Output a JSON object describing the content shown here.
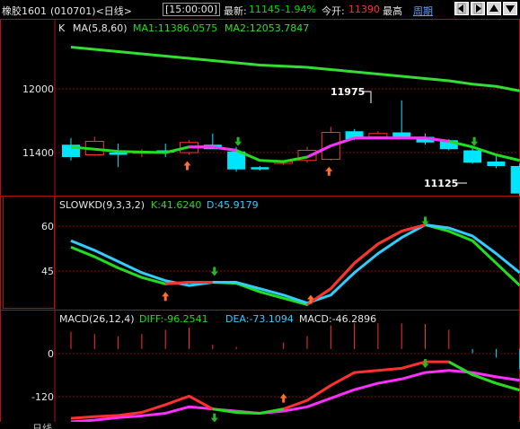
{
  "header": {
    "instrument": "橡胶1601",
    "code_period": "(010701)<日线>",
    "time": "[15:00:00]",
    "latest_label": "最新:",
    "latest_value": "11145",
    "change": "-1.94%",
    "open_label": "今开:",
    "open_value": "11390",
    "high_label": "最高",
    "period_link": "周期",
    "nav_icons": [
      "left-arrow-icon",
      "right-arrow-icon",
      "up-arrow-icon",
      "down-arrow-icon"
    ]
  },
  "price_panel": {
    "title_k": "K",
    "title_ma": "MA(5,8,60)",
    "ma1_text": "MA1:11386.0575",
    "ma2_text": "MA2:12053.7847",
    "axis_labels": [
      "12000",
      "11400"
    ],
    "annotation_high": "11975",
    "annotation_low": "11125"
  },
  "kd_panel": {
    "title": "SLOWKD(9,3,3,2)",
    "k_text": "K:41.6240",
    "d_text": "D:45.9179",
    "axis_labels": [
      "60",
      "45"
    ]
  },
  "macd_panel": {
    "title": "MACD(26,12,4)",
    "diff_text": "DIFF:-96.2541",
    "dea_text": "DEA:-73.1094",
    "macd_text": "MACD:-46.2896",
    "axis_labels": [
      "0",
      "-120"
    ]
  },
  "bottom": {
    "date_label": "日线"
  },
  "colors": {
    "up": "#ff3030",
    "down": "#00e5ff",
    "ma60": "#33dd33",
    "ma_green": "#22dd22",
    "ma_magenta": "#ff30ff",
    "kd_d": "#33ccff",
    "panel_border": "#b01010",
    "grid": "#8b0000"
  },
  "chart_data": [
    {
      "type": "candlestick",
      "candles": [
        {
          "o": 11580,
          "h": 11640,
          "l": 11440,
          "c": 11470
        },
        {
          "o": 11490,
          "h": 11650,
          "l": 11480,
          "c": 11610
        },
        {
          "o": 11510,
          "h": 11590,
          "l": 11380,
          "c": 11490
        },
        {
          "o": 11510,
          "h": 11540,
          "l": 11470,
          "c": 11520
        },
        {
          "o": 11530,
          "h": 11590,
          "l": 11470,
          "c": 11510
        },
        {
          "o": 11510,
          "h": 11620,
          "l": 11490,
          "c": 11600
        },
        {
          "o": 11580,
          "h": 11680,
          "l": 11560,
          "c": 11540
        },
        {
          "o": 11520,
          "h": 11560,
          "l": 11340,
          "c": 11360
        },
        {
          "o": 11380,
          "h": 11390,
          "l": 11350,
          "c": 11360
        },
        {
          "o": 11420,
          "h": 11440,
          "l": 11400,
          "c": 11430
        },
        {
          "o": 11440,
          "h": 11560,
          "l": 11420,
          "c": 11530
        },
        {
          "o": 11450,
          "h": 11740,
          "l": 11440,
          "c": 11690
        },
        {
          "o": 11700,
          "h": 11720,
          "l": 11620,
          "c": 11630
        },
        {
          "o": 11650,
          "h": 11700,
          "l": 11640,
          "c": 11680
        },
        {
          "o": 11690,
          "h": 11975,
          "l": 11660,
          "c": 11630
        },
        {
          "o": 11650,
          "h": 11680,
          "l": 11580,
          "c": 11600
        },
        {
          "o": 11620,
          "h": 11630,
          "l": 11530,
          "c": 11540
        },
        {
          "o": 11530,
          "h": 11560,
          "l": 11410,
          "c": 11420
        },
        {
          "o": 11430,
          "h": 11480,
          "l": 11370,
          "c": 11390
        },
        {
          "o": 11390,
          "h": 11410,
          "l": 11125,
          "c": 11145
        }
      ],
      "ma60": [
        12450,
        12430,
        12410,
        12390,
        12370,
        12350,
        12330,
        12310,
        12290,
        12280,
        12270,
        12250,
        12230,
        12210,
        12190,
        12170,
        12150,
        12120,
        12100,
        12060
      ],
      "ma_short": [
        11560,
        11540,
        11520,
        11515,
        11510,
        11560,
        11560,
        11530,
        11440,
        11430,
        11470,
        11570,
        11640,
        11640,
        11640,
        11640,
        11610,
        11560,
        11490,
        11440
      ],
      "ma_short_magenta_range": [
        5,
        7,
        10,
        16
      ],
      "ylim": [
        11150,
        12550
      ],
      "up_arrows": [
        5,
        11
      ],
      "down_arrows": [
        7,
        17
      ]
    },
    {
      "type": "line",
      "name": "SLOWKD",
      "series": [
        {
          "name": "K",
          "values": [
            51,
            48,
            44.5,
            41.5,
            39.5,
            40,
            40,
            39.7,
            37,
            35,
            33,
            38,
            46,
            52,
            56,
            58,
            56,
            53,
            46,
            39
          ]
        },
        {
          "name": "D",
          "values": [
            53,
            50,
            46.5,
            43,
            40.5,
            39,
            40,
            40,
            38,
            36,
            33.5,
            36,
            43,
            49,
            54,
            58,
            57,
            54.5,
            49,
            43
          ]
        }
      ],
      "ylim": [
        32,
        66
      ]
    },
    {
      "type": "line",
      "name": "MACD",
      "series": [
        {
          "name": "DIFF",
          "values": [
            -162,
            -158,
            -155,
            -148,
            -130,
            -110,
            -140,
            -148,
            -150,
            -140,
            -120,
            -85,
            -55,
            -50,
            -45,
            -30,
            -30,
            -60,
            -80,
            -96
          ]
        },
        {
          "name": "DEA",
          "values": [
            -170,
            -166,
            -160,
            -156,
            -150,
            -135,
            -140,
            -145,
            -150,
            -145,
            -135,
            -115,
            -95,
            -80,
            -70,
            -55,
            -50,
            -55,
            -65,
            -73
          ]
        }
      ],
      "histogram": [
        40,
        35,
        30,
        35,
        45,
        50,
        10,
        5,
        0,
        15,
        30,
        55,
        60,
        60,
        60,
        58,
        45,
        -10,
        -20,
        -46
      ],
      "ylim": [
        -170,
        50
      ]
    }
  ]
}
